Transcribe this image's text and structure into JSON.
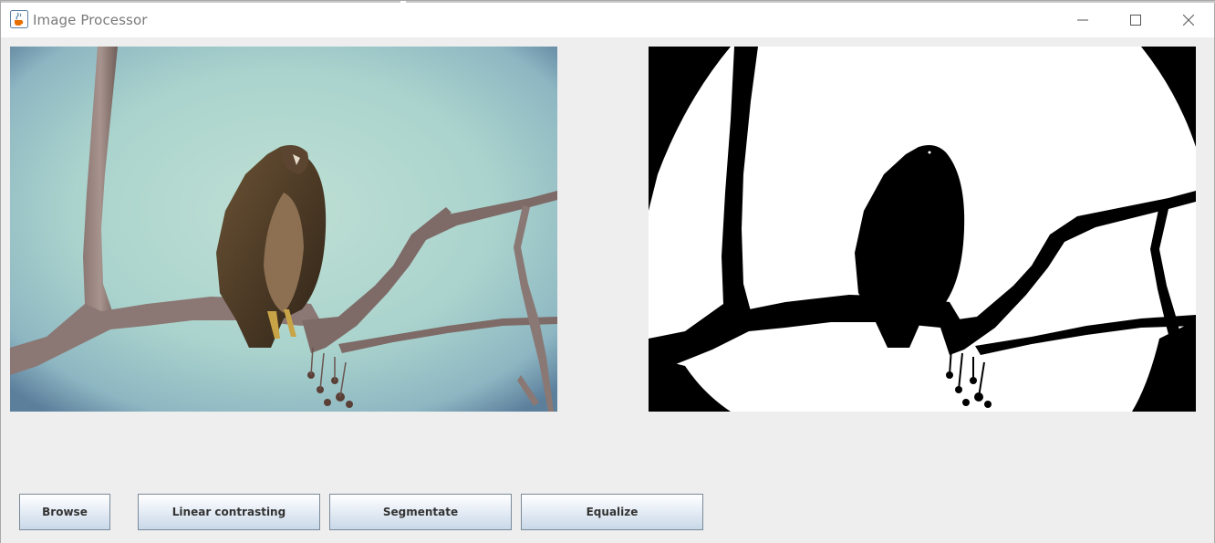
{
  "window": {
    "title": "Image Processor",
    "icons": {
      "app": "java-cup-icon",
      "minimize": "minimize-icon",
      "maximize": "maximize-icon",
      "close": "close-icon"
    }
  },
  "images": {
    "original": {
      "content": "hawk perched on bare branch against pale sky (color photo)"
    },
    "processed": {
      "content": "binary segmented hawk and branch silhouette (black and white)"
    }
  },
  "toolbar": {
    "browse_label": "Browse",
    "linear_label": "Linear contrasting",
    "segmentate_label": "Segmentate",
    "equalize_label": "Equalize"
  },
  "colors": {
    "window_bg": "#eeeeee",
    "titlebar_bg": "#ffffff",
    "button_border": "#7a8a99",
    "button_gradient_top": "#ffffff",
    "button_gradient_bottom": "#c9d8e8"
  }
}
